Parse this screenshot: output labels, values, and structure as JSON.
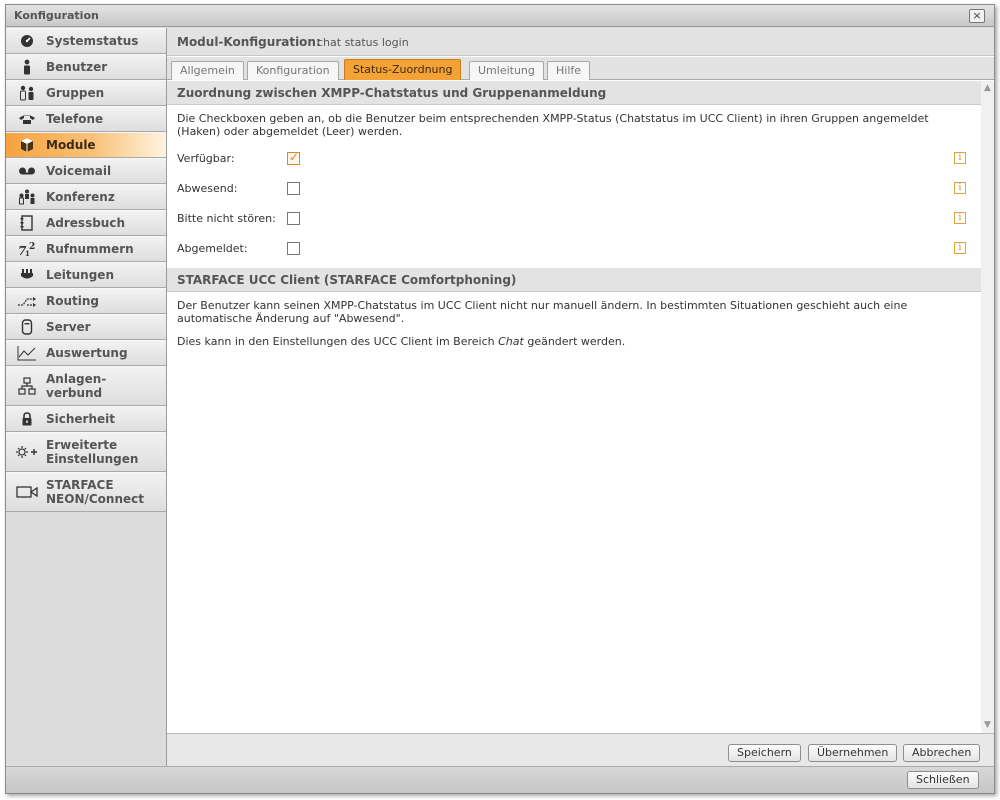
{
  "window": {
    "title": "Konfiguration",
    "close_glyph": "×"
  },
  "sidebar": {
    "items": [
      {
        "label": "Systemstatus",
        "icon": "dashboard-icon"
      },
      {
        "label": "Benutzer",
        "icon": "user-icon"
      },
      {
        "label": "Gruppen",
        "icon": "group-icon"
      },
      {
        "label": "Telefone",
        "icon": "phone-icon"
      },
      {
        "label": "Module",
        "icon": "module-cube-icon",
        "active": true
      },
      {
        "label": "Voicemail",
        "icon": "voicemail-icon"
      },
      {
        "label": "Konferenz",
        "icon": "conference-icon"
      },
      {
        "label": "Adressbuch",
        "icon": "addressbook-icon"
      },
      {
        "label": "Rufnummern",
        "icon": "numbers-icon"
      },
      {
        "label": "Leitungen",
        "icon": "plug-icon"
      },
      {
        "label": "Routing",
        "icon": "routing-icon"
      },
      {
        "label": "Server",
        "icon": "server-icon"
      },
      {
        "label": "Auswertung",
        "icon": "chart-icon"
      },
      {
        "label_line1": "Anlagen-",
        "label_line2": "verbund",
        "icon": "network-icon"
      },
      {
        "label": "Sicherheit",
        "icon": "lock-icon"
      },
      {
        "label_line1": "Erweiterte",
        "label_line2": "Einstellungen",
        "icon": "advanced-settings-icon"
      },
      {
        "label_line1": "STARFACE",
        "label_line2": "NEON/Connect",
        "icon": "camera-icon"
      }
    ]
  },
  "module": {
    "key": "Modul-Konfiguration:",
    "value": "chat status login"
  },
  "tabs": [
    {
      "label": "Allgemein"
    },
    {
      "label": "Konfiguration"
    },
    {
      "label": "Status-Zuordnung",
      "active": true
    },
    {
      "label": "Umleitung"
    },
    {
      "label": "Hilfe"
    }
  ],
  "section1": {
    "title": "Zuordnung zwischen XMPP-Chatstatus und Gruppenanmeldung",
    "desc_line1": "Die Checkboxen geben an, ob die Benutzer beim entsprechenden XMPP-Status (Chatstatus im UCC Client) in ihren Gruppen angemeldet",
    "desc_line2": "(Haken) oder abgemeldet (Leer) werden.",
    "rows": [
      {
        "label": "Verfügbar:",
        "checked": true
      },
      {
        "label": "Abwesend:",
        "checked": false
      },
      {
        "label": "Bitte nicht stören:",
        "checked": false
      },
      {
        "label": "Abgemeldet:",
        "checked": false
      }
    ],
    "check_glyph": "✓",
    "info_glyph": "i"
  },
  "section2": {
    "title": "STARFACE UCC Client (STARFACE Comfortphoning)",
    "p1_line1": "Der Benutzer kann seinen XMPP-Chatstatus im UCC Client nicht nur manuell ändern. In bestimmten Situationen geschieht auch eine",
    "p1_line2": "automatische Änderung auf \"Abwesend\".",
    "p2_before": "Dies kann in den Einstellungen des UCC Client im Bereich ",
    "p2_em": "Chat",
    "p2_after": " geändert werden."
  },
  "footer": {
    "save": "Speichern",
    "apply": "Übernehmen",
    "cancel": "Abbrechen"
  },
  "bottombar": {
    "close": "Schließen"
  },
  "colors": {
    "accent": "#f4a136"
  }
}
